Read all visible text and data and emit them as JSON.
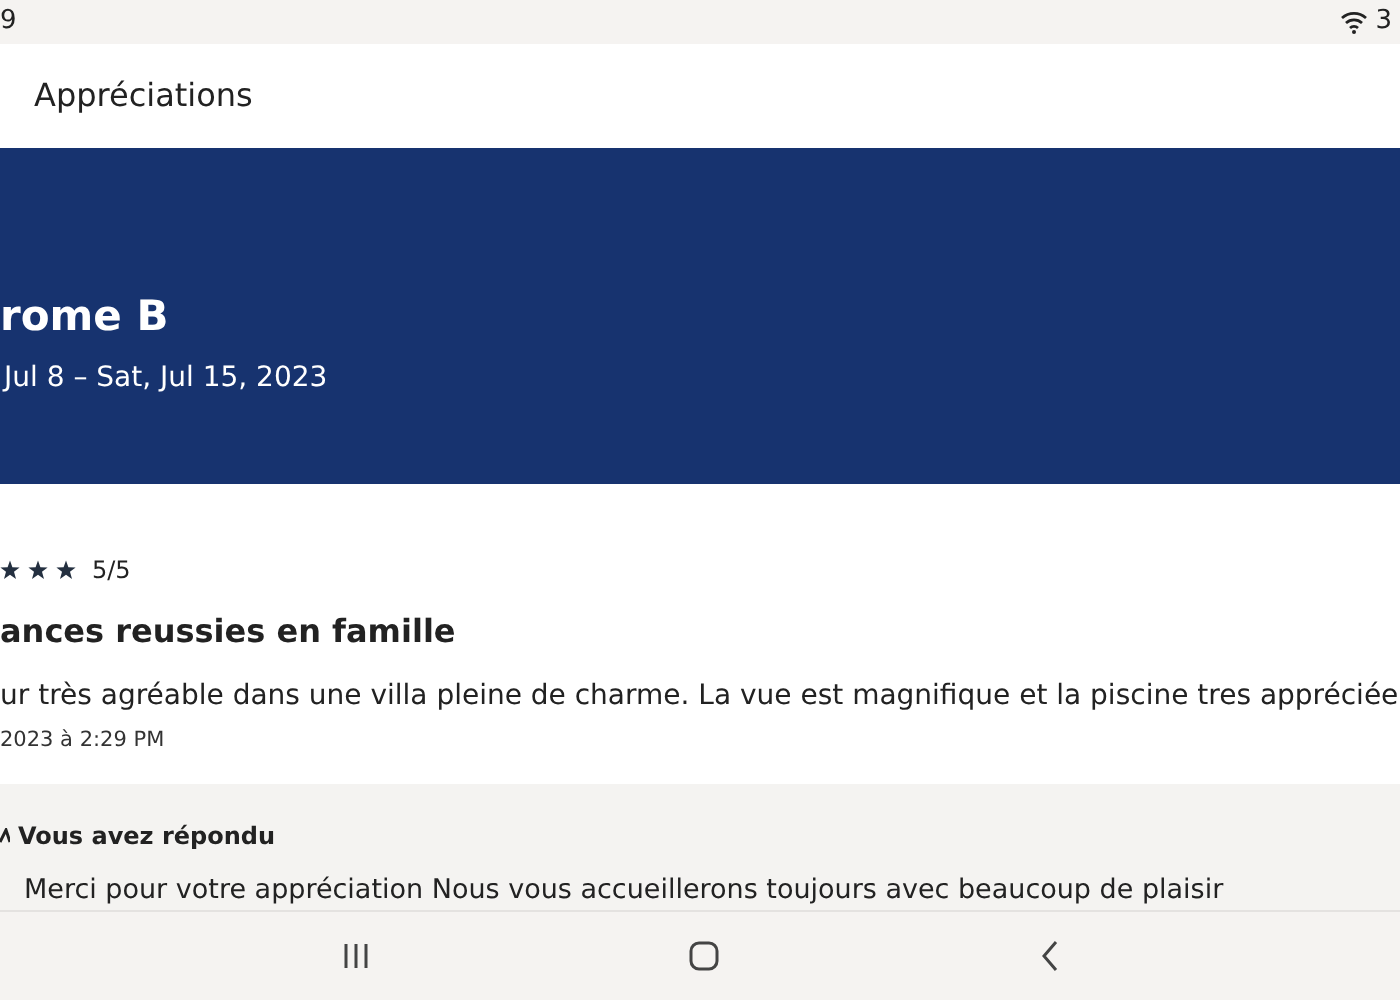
{
  "status_bar": {
    "time": "9",
    "battery": "3"
  },
  "app_bar": {
    "title": "Appréciations"
  },
  "header": {
    "name": "rome B",
    "dates": "Jul 8 – Sat, Jul 15, 2023"
  },
  "review": {
    "stars": 3,
    "score": "5/5",
    "title": "ances reussies en famille",
    "body": "ur très agréable dans une villa pleine de charme. La vue est magnifique et la piscine tres appréciée",
    "date": "2023 à 2:29 PM"
  },
  "reply": {
    "heading": "Vous avez répondu",
    "text": "Merci pour votre appréciation Nous vous accueillerons toujours avec beaucoup de plaisir"
  }
}
